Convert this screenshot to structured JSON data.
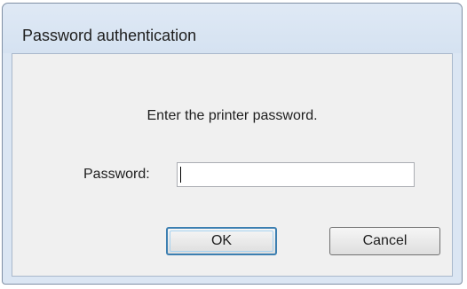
{
  "window": {
    "title": "Password authentication"
  },
  "dialog": {
    "prompt": "Enter the printer password.",
    "password_label": "Password:",
    "password_value": "",
    "ok_label": "OK",
    "cancel_label": "Cancel"
  }
}
